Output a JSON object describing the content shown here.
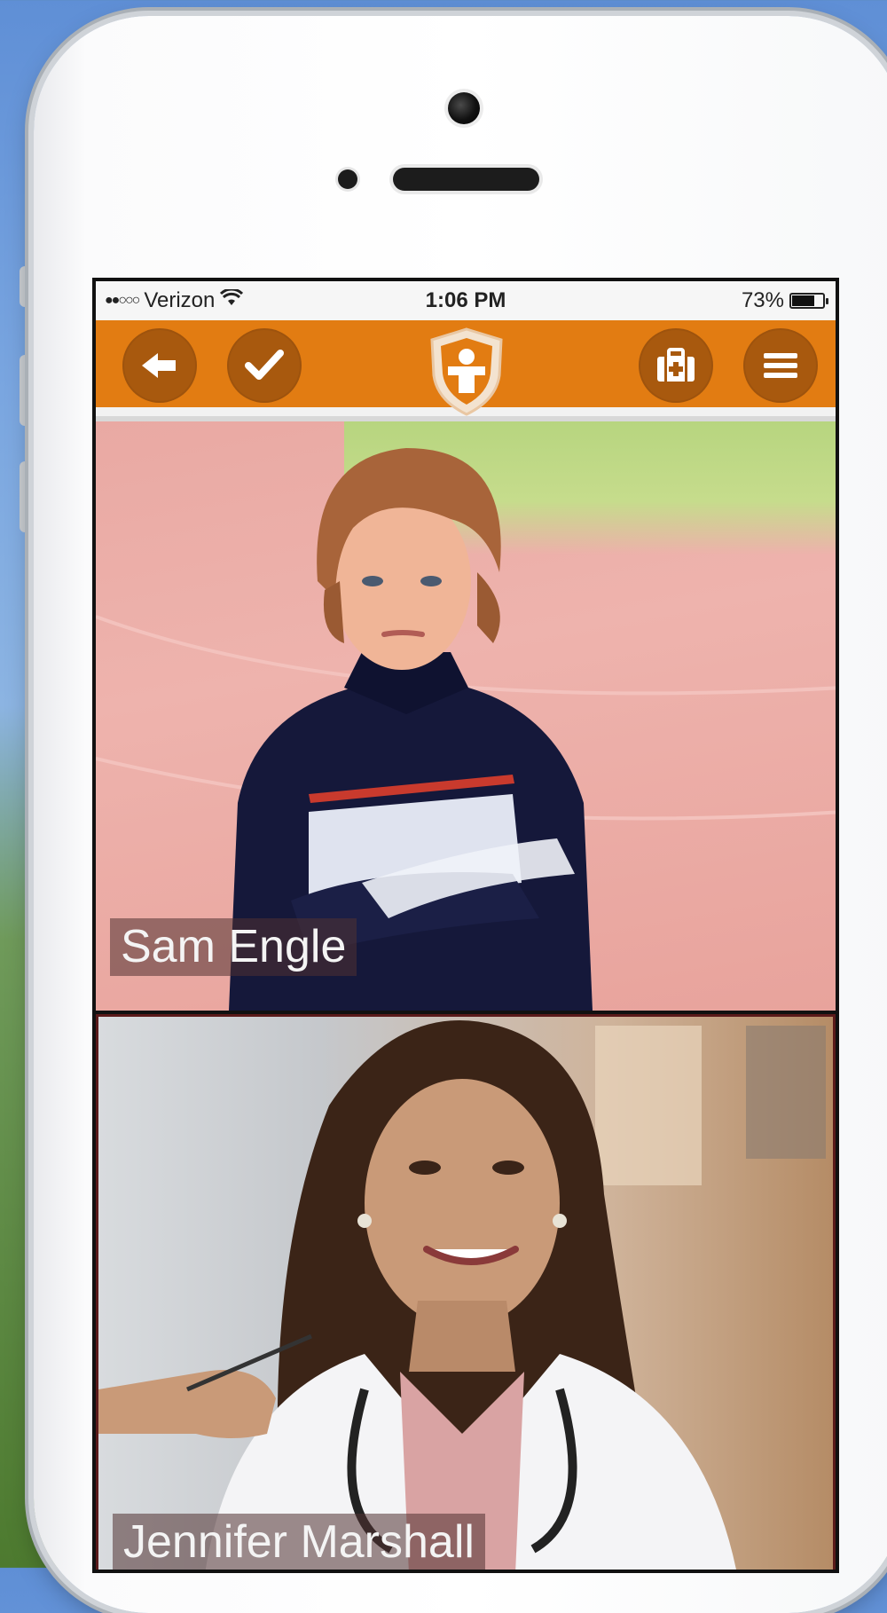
{
  "status_bar": {
    "signal": "●●○○○",
    "carrier": "Verizon",
    "time": "1:06 PM",
    "battery_percent_text": "73%",
    "battery_level": 0.73
  },
  "toolbar": {
    "back_icon": "back-arrow-icon",
    "confirm_icon": "checkmark-icon",
    "logo_icon": "shield-person-icon",
    "medical_kit_icon": "medical-kit-icon",
    "menu_icon": "hamburger-menu-icon",
    "accent_color": "#e27c12",
    "button_color": "#a8590e"
  },
  "participants": [
    {
      "name": "Sam Engle"
    },
    {
      "name": "Jennifer Marshall"
    }
  ]
}
